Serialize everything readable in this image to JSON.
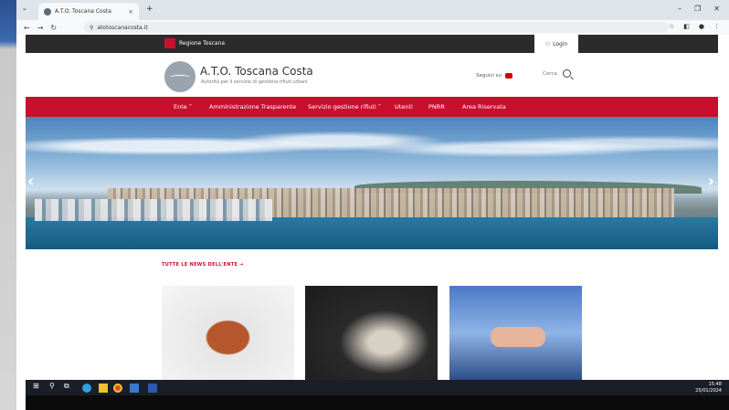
{
  "browser": {
    "tab_title": "A.T.O. Toscana Costa",
    "url": "atotoscanacosta.it",
    "tab_close": "×",
    "new_tab": "+"
  },
  "topbar": {
    "regione_label": "Regione Toscana",
    "login_label": "Login"
  },
  "header": {
    "title": "A.T.O. Toscana Costa",
    "subtitle": "Autorità per il servizio di gestione rifiuti urbani",
    "seguici": "Seguici su",
    "cerca": "Cerca"
  },
  "menu": {
    "items": [
      {
        "label": "Ente ˅"
      },
      {
        "label": "Amministrazione Trasparente"
      },
      {
        "label": "Servizio gestione rifiuti ˅"
      },
      {
        "label": "Utenti"
      },
      {
        "label": "PNRR"
      },
      {
        "label": "Area Riservata"
      }
    ]
  },
  "news": {
    "all_news_link": "TUTTE LE NEWS DELL'ENTE →"
  },
  "taskbar": {
    "time": "15:48",
    "date": "25/01/2024"
  },
  "colors": {
    "brand_red": "#c8102e",
    "topbar_dark": "#2b2b2b",
    "taskbar": "#1a1e26"
  },
  "icons": {
    "login": "user-icon",
    "search": "search-icon",
    "youtube": "youtube-icon"
  }
}
